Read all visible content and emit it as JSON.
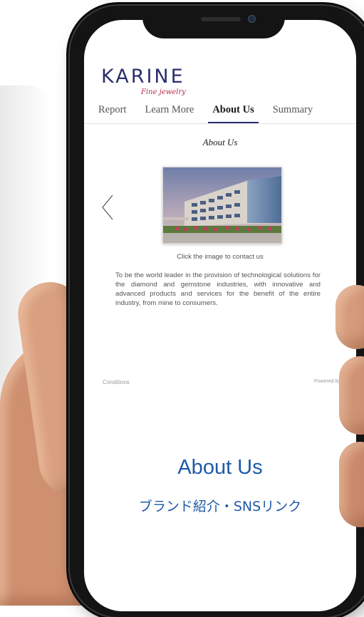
{
  "brand": {
    "logo": "KARINE",
    "tagline": "Fine jewelry"
  },
  "tabs": [
    {
      "label": "Report"
    },
    {
      "label": "Learn More"
    },
    {
      "label": "About Us"
    },
    {
      "label": "Summary"
    }
  ],
  "active_tab": "About Us",
  "about": {
    "title": "About Us",
    "image_caption": "Click the image to contact us",
    "description": "To be the world leader in the provision of technological solutions for the diamond and gemstone industries, with innovative and advanced products and services for the benefit of the entire industry, from mine to consumers."
  },
  "footer": {
    "conditions": "Conditions",
    "powered_by": "Powered by"
  },
  "overlay": {
    "title": "About Us",
    "subtitle": "ブランド紹介・SNSリンク"
  },
  "colors": {
    "brand_navy": "#2a2f6c",
    "tagline_red": "#b52a4a",
    "overlay_blue": "#1f5aa8"
  }
}
